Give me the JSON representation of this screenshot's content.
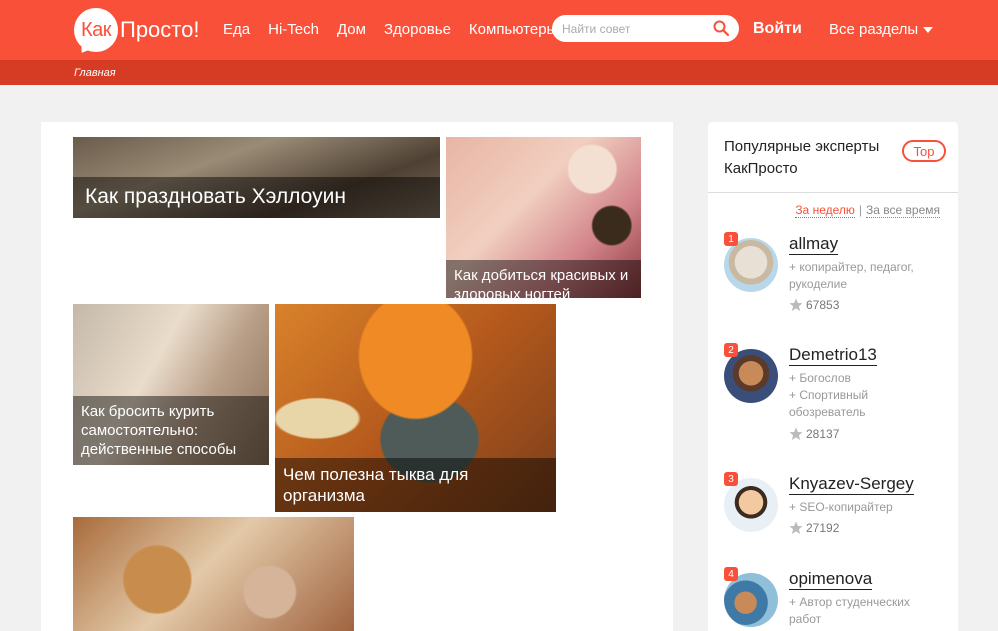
{
  "header": {
    "logo_bubble": "Как",
    "logo_text": "Просто!",
    "nav": [
      "Еда",
      "Hi-Tech",
      "Дом",
      "Здоровье",
      "Компьютеры"
    ],
    "search_placeholder": "Найти совет",
    "login": "Войти",
    "sections": "Все разделы"
  },
  "breadcrumb": "Главная",
  "articles": [
    {
      "title": "Как праздновать Хэллоуин"
    },
    {
      "title": "Как добиться красивых и здоровых ногтей"
    },
    {
      "title": "Как бросить курить самостоятельно: действенные способы"
    },
    {
      "title": "Чем полезна тыква для организма"
    }
  ],
  "sidebar": {
    "title": "Популярные эксперты КакПросто",
    "top_badge": "Top",
    "period_week": "За неделю",
    "period_all": "За все время",
    "experts": [
      {
        "rank": "1",
        "name": "allmay",
        "desc": "+ копирайтер, педагог, рукоделие",
        "score": "67853"
      },
      {
        "rank": "2",
        "name": "Demetrio13",
        "desc": "+ Богослов\n+ Спортивный обозреватель",
        "score": "28137"
      },
      {
        "rank": "3",
        "name": "Knyazev-Sergey",
        "desc": "+ SEO-копирайтер",
        "score": "27192"
      },
      {
        "rank": "4",
        "name": "opimenova",
        "desc": "+ Автор студенческих работ",
        "score": ""
      }
    ]
  },
  "colors": {
    "brand": "#f9503a",
    "brand_dark": "#d63b23"
  }
}
